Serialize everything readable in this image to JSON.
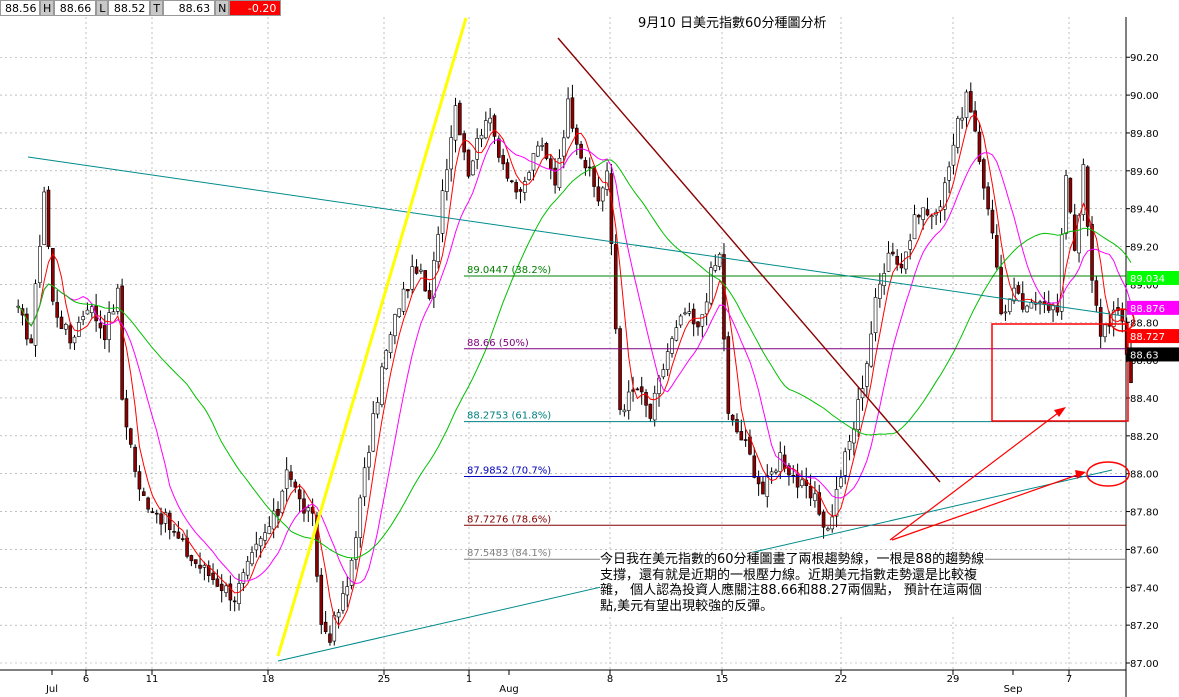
{
  "ohlc_bar": [
    {
      "value": "88.56",
      "tag": "H"
    },
    {
      "value": "88.66",
      "tag": "L"
    },
    {
      "value": "88.52",
      "tag": "T"
    },
    {
      "value": "88.63",
      "tag": "N"
    },
    {
      "value": "-0.20",
      "tag": ""
    }
  ],
  "chart_data": {
    "type": "candlestick",
    "title": "9月10  日美元指數60分種圖分析",
    "annotation": "今日我在美元指數的60分種圖畫了兩根趨勢線，一根是88的趨勢線支撐，還有就是近期的一根壓力線。近期美元指數走勢還是比較複雜， 個人認為投資人應關注88.66和88.27兩個點， 預計在這兩個點,美元有望出現較強的反彈。",
    "ylim": [
      87.0,
      90.3
    ],
    "y_ticks": [
      "90.20",
      "90.00",
      "89.80",
      "89.60",
      "89.40",
      "89.20",
      "89.00",
      "88.80",
      "88.60",
      "88.40",
      "88.20",
      "88.00",
      "87.80",
      "87.60",
      "87.40",
      "87.20",
      "87.00"
    ],
    "x_ticks": [
      "Jul",
      "6",
      "11",
      "18",
      "25",
      "1",
      "Aug",
      "8",
      "15",
      "22",
      "29",
      "Sep",
      "7"
    ],
    "price_path": [
      [
        0,
        88.85
      ],
      [
        3,
        88.7
      ],
      [
        6,
        89.5
      ],
      [
        8,
        88.9
      ],
      [
        12,
        88.7
      ],
      [
        16,
        88.9
      ],
      [
        20,
        88.75
      ],
      [
        23,
        88.95
      ],
      [
        24,
        88.4
      ],
      [
        28,
        87.9
      ],
      [
        34,
        87.75
      ],
      [
        40,
        87.55
      ],
      [
        45,
        87.45
      ],
      [
        50,
        87.35
      ],
      [
        55,
        87.6
      ],
      [
        60,
        87.8
      ],
      [
        62,
        88.05
      ],
      [
        65,
        87.85
      ],
      [
        68,
        87.75
      ],
      [
        70,
        87.2
      ],
      [
        72,
        87.15
      ],
      [
        76,
        87.4
      ],
      [
        80,
        88.0
      ],
      [
        84,
        88.55
      ],
      [
        88,
        88.9
      ],
      [
        92,
        89.1
      ],
      [
        95,
        88.9
      ],
      [
        98,
        89.5
      ],
      [
        101,
        89.95
      ],
      [
        104,
        89.6
      ],
      [
        108,
        89.9
      ],
      [
        112,
        89.65
      ],
      [
        116,
        89.45
      ],
      [
        120,
        89.75
      ],
      [
        124,
        89.55
      ],
      [
        127,
        89.95
      ],
      [
        130,
        89.7
      ],
      [
        134,
        89.45
      ],
      [
        136,
        89.6
      ],
      [
        139,
        88.35
      ],
      [
        143,
        88.45
      ],
      [
        146,
        88.3
      ],
      [
        150,
        88.65
      ],
      [
        154,
        88.85
      ],
      [
        157,
        88.75
      ],
      [
        160,
        89.05
      ],
      [
        162,
        89.15
      ],
      [
        164,
        88.3
      ],
      [
        168,
        88.15
      ],
      [
        172,
        87.9
      ],
      [
        176,
        88.1
      ],
      [
        180,
        87.95
      ],
      [
        184,
        87.85
      ],
      [
        187,
        87.7
      ],
      [
        190,
        88.0
      ],
      [
        193,
        88.25
      ],
      [
        196,
        88.6
      ],
      [
        198,
        88.9
      ],
      [
        201,
        89.2
      ],
      [
        204,
        89.1
      ],
      [
        208,
        89.4
      ],
      [
        212,
        89.35
      ],
      [
        216,
        89.75
      ],
      [
        219,
        90.0
      ],
      [
        222,
        89.65
      ],
      [
        225,
        89.3
      ],
      [
        227,
        88.85
      ],
      [
        230,
        88.95
      ],
      [
        233,
        88.85
      ],
      [
        236,
        88.95
      ],
      [
        240,
        88.85
      ],
      [
        242,
        89.6
      ],
      [
        244,
        89.2
      ],
      [
        246,
        89.6
      ],
      [
        248,
        89.0
      ],
      [
        250,
        88.75
      ],
      [
        253,
        88.85
      ],
      [
        255,
        88.8
      ],
      [
        257,
        88.5
      ]
    ],
    "moving_averages": [
      {
        "color": "#ff0000",
        "period": 5
      },
      {
        "color": "#ff00ff",
        "period": 12
      },
      {
        "color": "#00c000",
        "period": 40
      }
    ],
    "fibonacci_levels": [
      {
        "label": "89.0447 (38.2%)",
        "value": 89.0447,
        "color": "#008000"
      },
      {
        "label": "88.66 (50%)",
        "value": 88.66,
        "color": "#800080"
      },
      {
        "label": "88.2753 (61.8%)",
        "value": 88.2753,
        "color": "#008080"
      },
      {
        "label": "87.9852 (70.7%)",
        "value": 87.9852,
        "color": "#0000c0"
      },
      {
        "label": "87.7276 (78.6%)",
        "value": 87.7276,
        "color": "#800000"
      },
      {
        "label": "87.5483 (84.1%)",
        "value": 87.5483,
        "color": "#808080"
      }
    ],
    "right_labels": [
      {
        "text": "89.034",
        "value": 89.034,
        "bg": "#00ff00",
        "fg": "#ffffff"
      },
      {
        "text": "88.876",
        "value": 88.876,
        "bg": "#ff00ff",
        "fg": "#ffffff"
      },
      {
        "text": "88.727",
        "value": 88.727,
        "bg": "#ff0000",
        "fg": "#ffffff"
      },
      {
        "text": "88.63",
        "value": 88.63,
        "bg": "#000000",
        "fg": "#ffffff"
      }
    ]
  }
}
